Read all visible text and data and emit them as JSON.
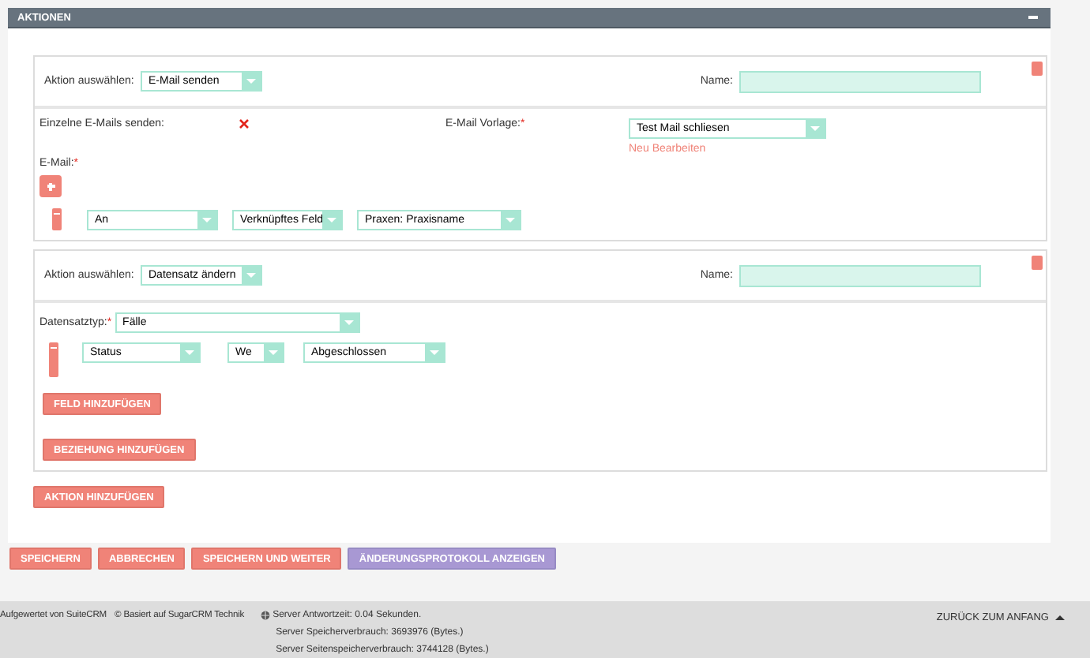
{
  "panel": {
    "title": "AKTIONEN"
  },
  "actions": [
    {
      "kind": "email",
      "select_label": "Aktion auswählen:",
      "select_value": "E-Mail senden",
      "name_label": "Name:",
      "single_label": "Einzelne E-Mails senden:",
      "single_checked": false,
      "template_label": "E-Mail Vorlage:",
      "template_required": "*",
      "template_value": "Test Mail schliesen",
      "template_links": [
        "Neu",
        "Bearbeiten"
      ],
      "email_label": "E-Mail:",
      "email_required": "*",
      "recipients": [
        {
          "type": "An",
          "source": "Verknüpftes Feld",
          "value": "Praxen: Praxisname"
        }
      ]
    },
    {
      "kind": "record",
      "select_label": "Aktion auswählen:",
      "select_value": "Datensatz ändern",
      "name_label": "Name:",
      "record_type_label": "Datensatztyp:",
      "record_type_required": "*",
      "record_type_value": "Fälle",
      "fields": [
        {
          "field": "Status",
          "operator": "We",
          "value": "Abgeschlossen"
        }
      ],
      "buttons": [
        "FELD HINZUFÜGEN",
        "BEZIEHUNG HINZUFÜGEN"
      ]
    }
  ],
  "add_action_button": "AKTION HINZUFÜGEN",
  "form_buttons": [
    {
      "label": "SPEICHERN",
      "kind": "primary"
    },
    {
      "label": "ABBRECHEN",
      "kind": "primary"
    },
    {
      "label": "SPEICHERN UND WEITER",
      "kind": "primary"
    },
    {
      "label": "ÄNDERUNGSPROTOKOLL ANZEIGEN",
      "kind": "secondary"
    }
  ],
  "footer": {
    "powered": "Aufgewertet von SuiteCRM",
    "based": "© Basiert auf SugarCRM Technik",
    "server_lines": [
      "Server Antwortzeit: 0.04 Sekunden.",
      "Server Speicherverbrauch: 3693976 (Bytes.)",
      "Server Seitenspeicherverbrauch: 3744128 (Bytes.)"
    ],
    "back_to_top": "ZURÜCK ZUM ANFANG"
  }
}
